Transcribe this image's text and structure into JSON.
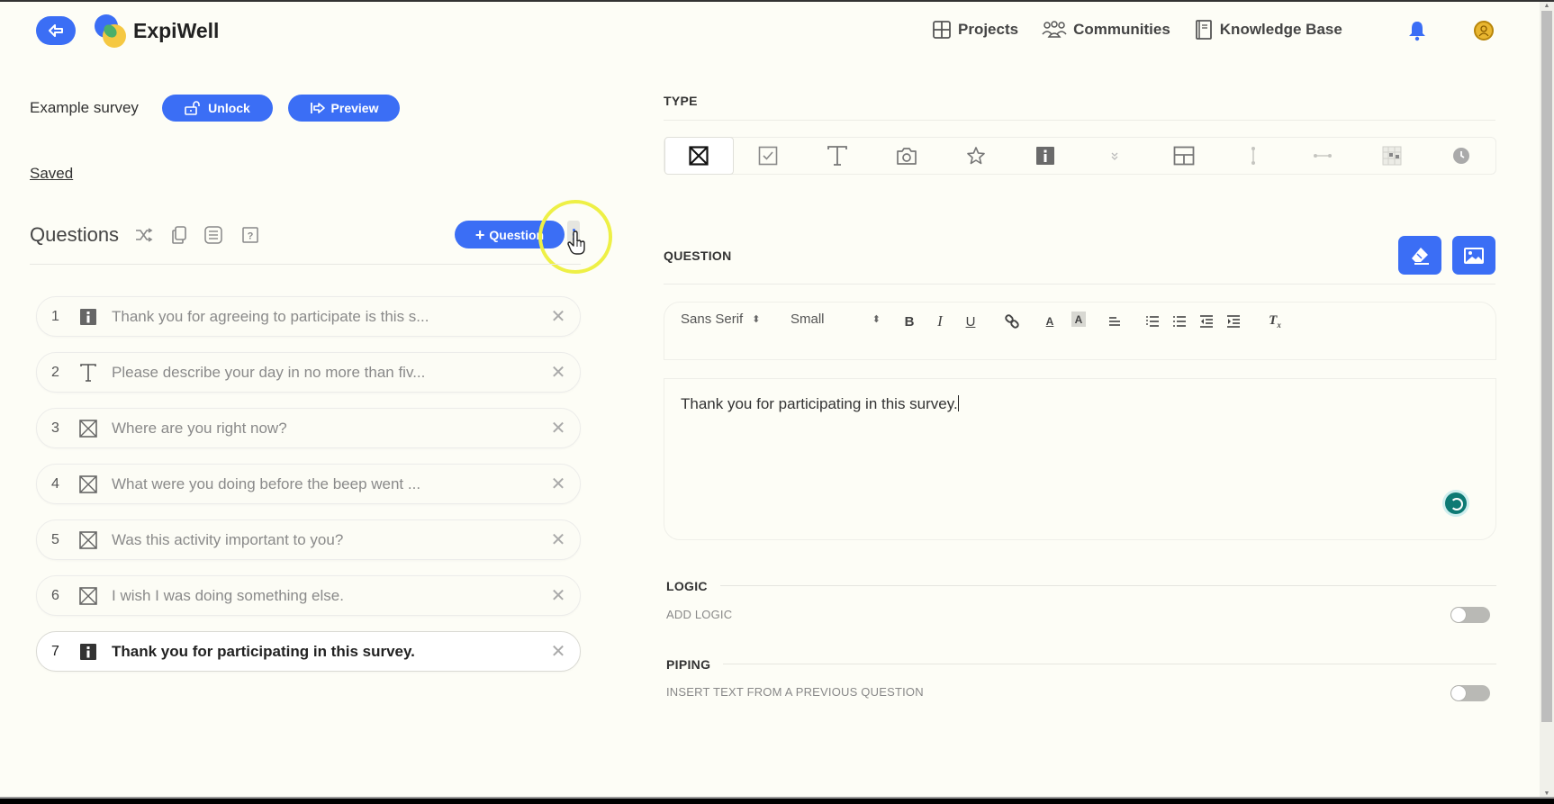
{
  "header": {
    "brand": "ExpiWell",
    "nav": [
      {
        "label": "Projects",
        "icon": "grid-icon"
      },
      {
        "label": "Communities",
        "icon": "people-icon"
      },
      {
        "label": "Knowledge Base",
        "icon": "book-icon"
      }
    ],
    "colors": {
      "accent": "#3b6ef5",
      "avatar": "#e9b630"
    }
  },
  "survey": {
    "title": "Example survey",
    "unlock_label": "Unlock",
    "preview_label": "Preview",
    "saved_label": "Saved"
  },
  "questions_panel": {
    "title": "Questions",
    "add_button_label": "Question",
    "items": [
      {
        "number": "1",
        "type": "info",
        "text": "Thank you for agreeing to participate is this s...",
        "active": false
      },
      {
        "number": "2",
        "type": "text",
        "text": "Please describe your day in no more than fiv...",
        "active": false
      },
      {
        "number": "3",
        "type": "single-choice",
        "text": "Where are you right now?",
        "active": false
      },
      {
        "number": "4",
        "type": "single-choice",
        "text": "What were you doing before the beep went ...",
        "active": false
      },
      {
        "number": "5",
        "type": "single-choice",
        "text": "Was this activity important to you?",
        "active": false
      },
      {
        "number": "6",
        "type": "single-choice",
        "text": "I wish I was doing something else.",
        "active": false
      },
      {
        "number": "7",
        "type": "info",
        "text": "Thank you for participating in this survey.",
        "active": true
      }
    ]
  },
  "editor": {
    "type_label": "TYPE",
    "types": [
      "single-choice",
      "multiple-choice",
      "text",
      "photo",
      "rating",
      "info",
      "dropdown",
      "grid",
      "vertical-slider",
      "horizontal-slider",
      "matrix",
      "time"
    ],
    "selected_type": "single-choice",
    "question_label": "QUESTION",
    "font_select": "Sans Serif",
    "size_select": "Small",
    "question_text": "Thank you for participating in this survey.",
    "logic_label": "LOGIC",
    "add_logic_label": "ADD LOGIC",
    "add_logic_enabled": false,
    "piping_label": "PIPING",
    "piping_sub_label": "INSERT TEXT FROM A PREVIOUS QUESTION",
    "piping_enabled": false
  }
}
